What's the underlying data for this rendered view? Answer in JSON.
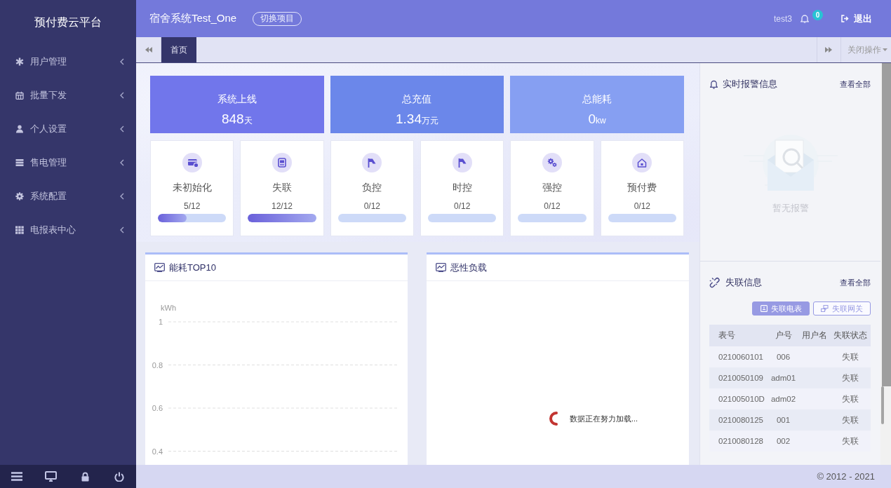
{
  "sidebar": {
    "title": "预付费云平台",
    "items": [
      {
        "label": "用户管理",
        "expanded": false
      },
      {
        "label": "批量下发",
        "expanded": false
      },
      {
        "label": "个人设置",
        "expanded": false
      },
      {
        "label": "售电管理",
        "expanded": false
      },
      {
        "label": "系统配置",
        "expanded": false
      },
      {
        "label": "电报表中心",
        "expanded": false
      }
    ]
  },
  "header": {
    "project_title": "宿舍系统Test_One",
    "switch_button": "切换项目",
    "username": "test3",
    "notification_count": "0",
    "logout": "退出"
  },
  "tabbar": {
    "tabs": [
      {
        "label": "首页",
        "selected": true
      }
    ],
    "close_menu": "关闭操作"
  },
  "summary_cards": [
    {
      "title": "系统上线",
      "value": "848",
      "unit": "天"
    },
    {
      "title": "总充值",
      "value": "1.34",
      "unit": "万元"
    },
    {
      "title": "总能耗",
      "value": "0",
      "unit": "kw"
    }
  ],
  "status_cards": [
    {
      "label": "未初始化",
      "count": "5/12",
      "level": 0.4167
    },
    {
      "label": "失联",
      "count": "12/12",
      "level": 1
    },
    {
      "label": "负控",
      "count": "0/12",
      "level": 0
    },
    {
      "label": "时控",
      "count": "0/12",
      "level": 0
    },
    {
      "label": "强控",
      "count": "0/12",
      "level": 0
    },
    {
      "label": "预付费",
      "count": "0/12",
      "level": 0
    }
  ],
  "panels": [
    {
      "kind": "axes",
      "title": "能耗TOP10",
      "axis_label": "kWh",
      "tick_labels": [
        "1",
        "0.8",
        "0.6",
        "0.4"
      ]
    },
    {
      "kind": "loading",
      "title": "恶性负载",
      "loading_text": "数据正在努力加载..."
    }
  ],
  "alarms": {
    "title": "实时报警信息",
    "view_all": "查看全部",
    "empty_text": "暂无报警"
  },
  "offline": {
    "title": "失联信息",
    "view_all": "查看全部",
    "tabs": [
      {
        "label": "失联电表",
        "selected": true
      },
      {
        "label": "失联网关",
        "selected": false
      }
    ],
    "table": {
      "columns": [
        "表号",
        "户号",
        "用户名",
        "失联状态"
      ],
      "rows": [
        {
          "meter": "0210060101",
          "account": "006",
          "status": "失联"
        },
        {
          "meter": "0210050109",
          "account": "adm01",
          "status": "失联"
        },
        {
          "meter": "021005010D",
          "account": "adm02",
          "status": "失联"
        },
        {
          "meter": "0210080125",
          "account": "001",
          "status": "失联"
        },
        {
          "meter": "0210080128",
          "account": "002",
          "status": "失联"
        }
      ]
    }
  },
  "footer": {
    "copyright": "© 2012 - 2021"
  }
}
